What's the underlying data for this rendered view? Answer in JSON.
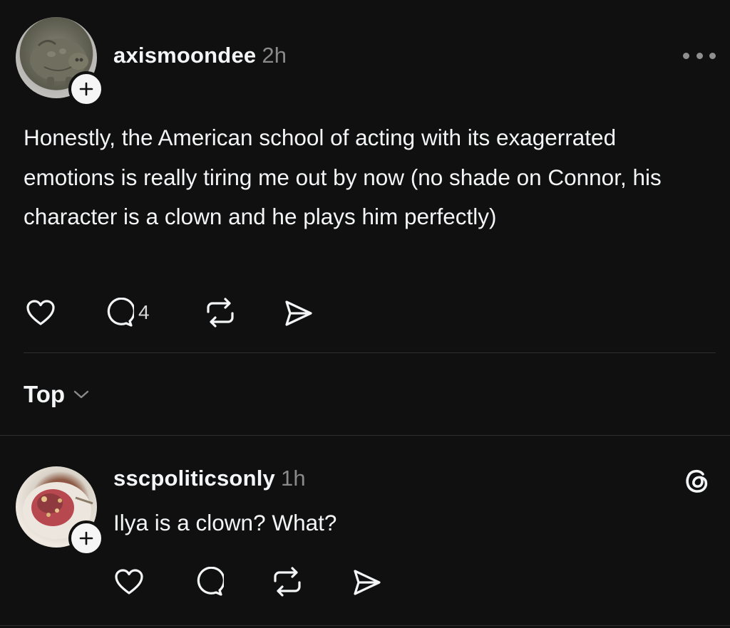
{
  "post": {
    "username": "axismoondee",
    "time": "2h",
    "text": "Honestly, the American school of acting with its exagerrated emotions is really tiring me out by now (no shade on Connor, his character is a clown and he plays him perfectly)",
    "replies_count": "4",
    "icons": [
      "heart-icon",
      "comment-icon",
      "repost-icon",
      "share-icon",
      "more-icon",
      "follow-plus-icon"
    ]
  },
  "sort": {
    "label": "Top",
    "icon": "chevron-down-icon"
  },
  "reply": {
    "username": "sscpoliticsonly",
    "time": "1h",
    "text": "Ilya is a clown? What?",
    "icons": [
      "heart-icon",
      "comment-icon",
      "repost-icon",
      "share-icon",
      "threads-logo-icon",
      "follow-plus-icon"
    ]
  },
  "colors": {
    "background": "#101010",
    "text": "#f3f5f7",
    "secondary": "#8a8a8a",
    "divider": "#2e2e2e"
  }
}
